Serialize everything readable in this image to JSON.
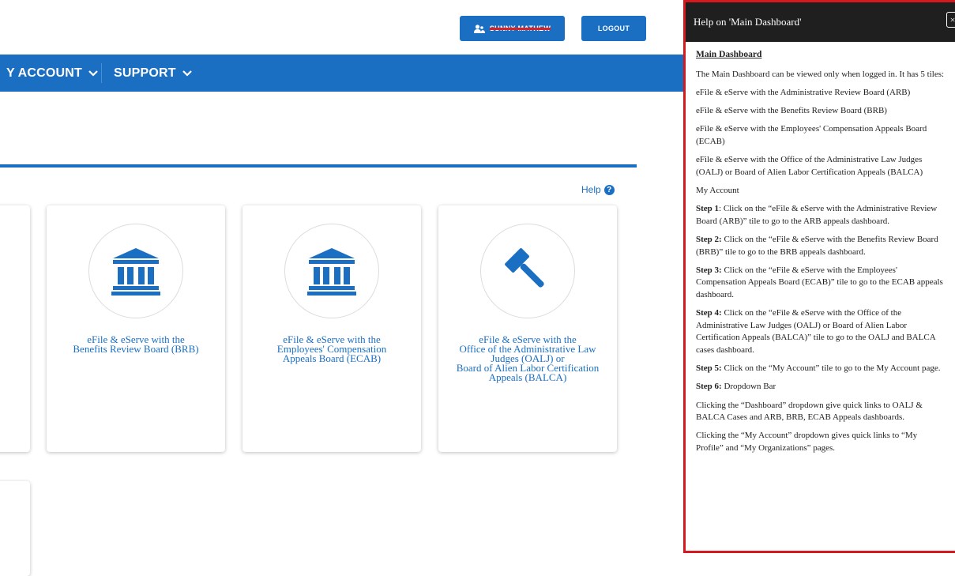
{
  "header": {
    "user_name": "SUNNY MATHEW",
    "logout_label": "LOGOUT"
  },
  "nav": {
    "my_account_label": "Y ACCOUNT",
    "support_label": "SUPPORT"
  },
  "main": {
    "help_label": "Help",
    "tiles": [
      {
        "label_line1": "eFile & eServe with the",
        "label_line2": "Benefits Review Board (BRB)",
        "icon": "building-icon"
      },
      {
        "label_line1": "eFile & eServe with the",
        "label_line2": "Employees' Compensation",
        "label_line3": "Appeals Board (ECAB)",
        "icon": "building-icon"
      },
      {
        "label_line1": "eFile & eServe with the",
        "label_line2": "Office of the Administrative Law",
        "label_line3": "Judges (OALJ) or",
        "label_line4": "Board of Alien Labor Certification",
        "label_line5": "Appeals (BALCA)",
        "icon": "gavel-icon"
      }
    ]
  },
  "help_panel": {
    "title": "Help on 'Main Dashboard'",
    "close_label": "×",
    "section_title": "Main Dashboard",
    "intro": "The Main Dashboard can be viewed only when logged in. It has 5 tiles:",
    "tiles_list": [
      "eFile & eServe with the Administrative Review Board (ARB)",
      "eFile & eServe with the  Benefits Review Board (BRB)",
      "eFile & eServe with the  Employees' Compensation Appeals Board (ECAB)",
      "eFile & eServe with the Office of the Administrative Law Judges (OALJ) or Board of Alien Labor Certification Appeals (BALCA)",
      "My Account"
    ],
    "steps": [
      {
        "label": "Step 1",
        "text": ": Click on the “eFile & eServe with the Administrative Review Board (ARB)” tile to go to the ARB appeals dashboard."
      },
      {
        "label": "Step 2:",
        "text": " Click on the “eFile & eServe with the  Benefits Review Board (BRB)” tile to go to the BRB appeals dashboard."
      },
      {
        "label": "Step 3:",
        "text": " Click on the “eFile & eServe with the  Employees' Compensation Appeals Board (ECAB)” tile to go to the ECAB appeals dashboard."
      },
      {
        "label": "Step 4:",
        "text": " Click on the “eFile & eServe with the Office of the Administrative Law Judges (OALJ) or Board of Alien Labor Certification Appeals (BALCA)” tile to go to the OALJ and BALCA cases dashboard."
      },
      {
        "label": "Step 5:",
        "text": " Click on the “My Account” tile to go to the My Account page."
      },
      {
        "label": "Step 6:",
        "text": " Dropdown Bar"
      }
    ],
    "dropdown_notes": [
      "Clicking the “Dashboard” dropdown give quick links to OALJ & BALCA Cases and ARB, BRB, ECAB Appeals dashboards.",
      "Clicking the “My Account” dropdown gives quick links to “My Profile” and “My Organizations” pages."
    ]
  },
  "colors": {
    "primary": "#1b6fc2",
    "panel_header": "#1f1f1f",
    "highlight_border": "#d6191f"
  }
}
